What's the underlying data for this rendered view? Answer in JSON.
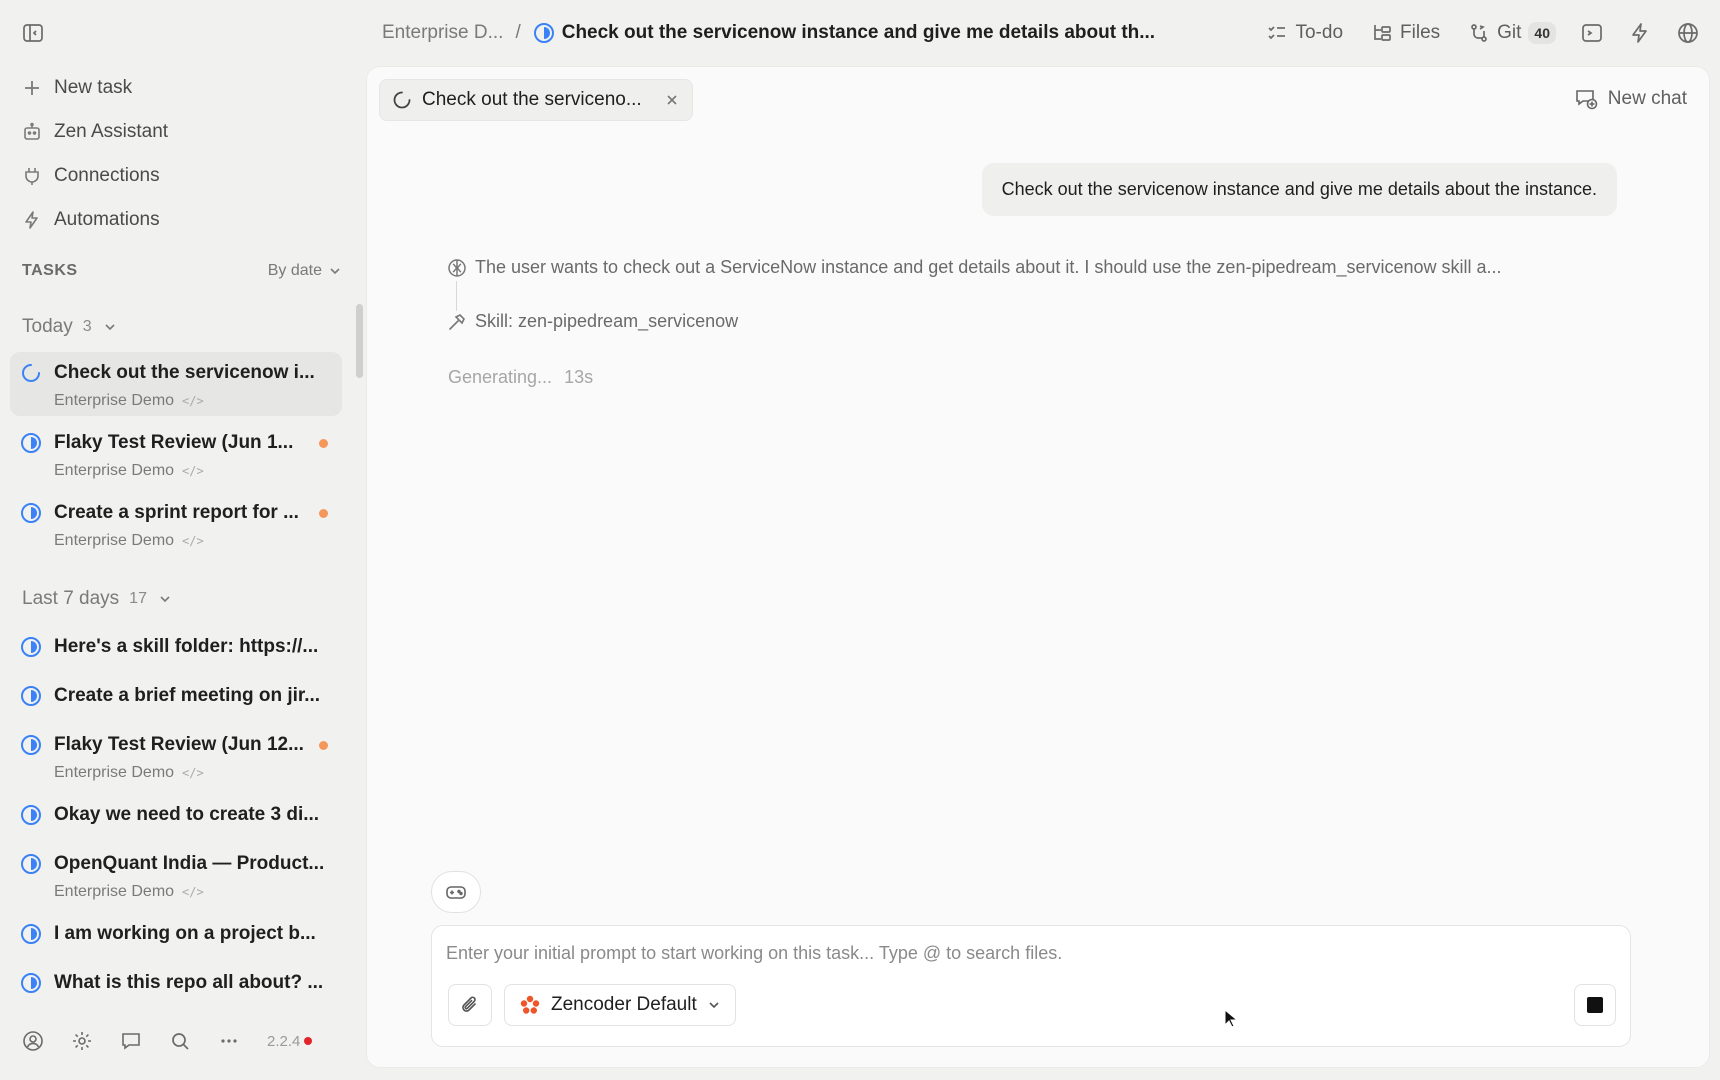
{
  "header": {
    "breadcrumb_parent": "Enterprise D...",
    "breadcrumb_separator": "/",
    "breadcrumb_current": "Check out the servicenow instance and give me details about th...",
    "actions": {
      "todo_label": "To-do",
      "files_label": "Files",
      "git_label": "Git",
      "git_count": "40"
    },
    "icons": [
      "sidebar-toggle-icon",
      "todo-icon",
      "files-icon",
      "git-icon",
      "terminal-icon",
      "lightning-icon",
      "globe-icon"
    ]
  },
  "sidebar": {
    "nav": {
      "new_task": "New task",
      "zen_assistant": "Zen Assistant",
      "connections": "Connections",
      "automations": "Automations"
    },
    "tasks_title": "TASKS",
    "sort_label": "By date",
    "groups": {
      "today": {
        "label": "Today",
        "count": "3"
      },
      "last7": {
        "label": "Last 7 days",
        "count": "17"
      }
    },
    "tasks": [
      {
        "title": "Check out the servicenow i...",
        "project": "Enterprise Demo",
        "status": "running",
        "unread": false,
        "active": true
      },
      {
        "title": "Flaky Test Review (Jun 1...",
        "project": "Enterprise Demo",
        "status": "in-progress",
        "unread": true
      },
      {
        "title": "Create a sprint report for ...",
        "project": "Enterprise Demo",
        "status": "in-progress",
        "unread": true
      },
      {
        "title": "Here's a skill folder: https://...",
        "status": "in-progress"
      },
      {
        "title": "Create a brief meeting on jir...",
        "status": "in-progress"
      },
      {
        "title": "Flaky Test Review (Jun 12...",
        "project": "Enterprise Demo",
        "status": "in-progress",
        "unread": true
      },
      {
        "title": "Okay we need to create 3 di...",
        "status": "in-progress"
      },
      {
        "title": "OpenQuant India — Product...",
        "project": "Enterprise Demo",
        "status": "in-progress"
      },
      {
        "title": "I am working on a project b...",
        "status": "in-progress"
      },
      {
        "title": "What is this repo all about? ...",
        "status": "in-progress"
      }
    ],
    "code_tag": "</>",
    "footer": {
      "version": "2.2.4",
      "icons": [
        "account-icon",
        "settings-icon",
        "chat-icon",
        "search-icon",
        "more-icon"
      ]
    }
  },
  "main": {
    "tab_label": "Check out the serviceno...",
    "new_chat_label": "New chat",
    "user_message": "Check out the servicenow instance and give me details about the instance.",
    "thinking_text": "The user wants to check out a ServiceNow instance and get details about it. I should use the zen-pipedream_servicenow skill a...",
    "skill_text": "Skill: zen-pipedream_servicenow",
    "generating_label": "Generating...",
    "generating_time": "13s",
    "composer": {
      "placeholder": "Enter your initial prompt to start working on this task... Type @ to search files.",
      "value": "",
      "model_label": "Zencoder Default"
    }
  },
  "colors": {
    "accent_blue": "#3b82f6",
    "unread_dot": "#f5975a",
    "version_dot": "#e0262a",
    "model_logo": "#f0552a"
  }
}
